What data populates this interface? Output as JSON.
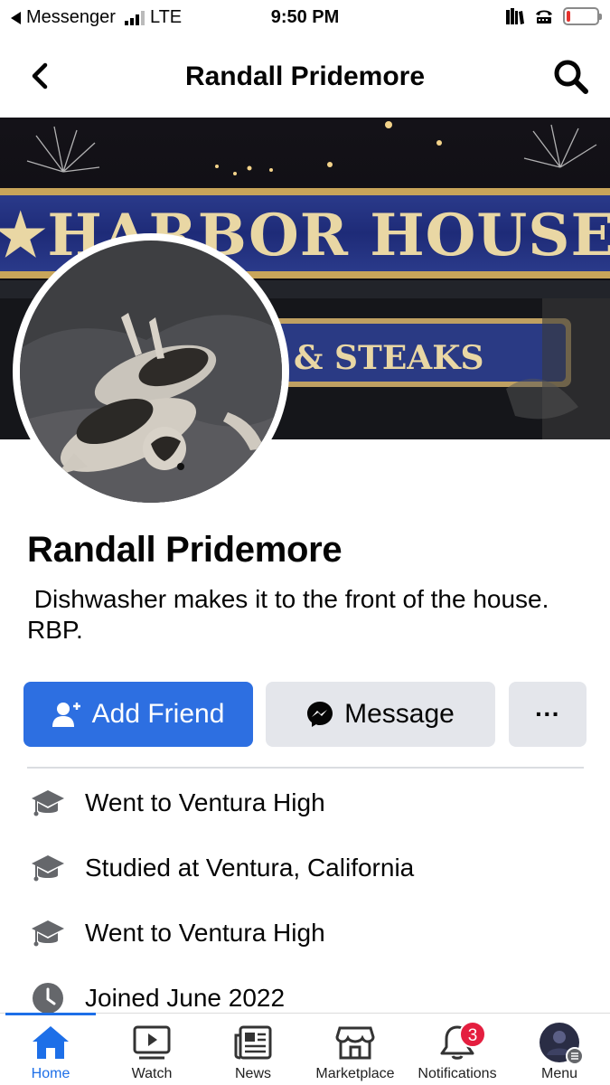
{
  "status_bar": {
    "back_app": "Messenger",
    "network": "LTE",
    "time": "9:50 PM",
    "battery_level": 0.12
  },
  "header": {
    "title": "Randall Pridemore"
  },
  "cover": {
    "sign_text_1": "★HARBOR HOUSE★",
    "sign_text_2": "& STEAKS"
  },
  "profile": {
    "name": "Randall Pridemore",
    "bio": " Dishwasher makes it to the front of the house. RBP."
  },
  "actions": {
    "add_friend_label": "Add Friend",
    "message_label": "Message",
    "more_label": "···"
  },
  "info": [
    {
      "icon": "education-icon",
      "text": "Went to Ventura High"
    },
    {
      "icon": "education-icon",
      "text": "Studied at Ventura, California"
    },
    {
      "icon": "education-icon",
      "text": "Went to Ventura High"
    },
    {
      "icon": "clock-icon",
      "text": "Joined June 2022"
    }
  ],
  "tabbar": {
    "tabs": [
      {
        "label": "Home",
        "icon": "home-icon",
        "active": true
      },
      {
        "label": "Watch",
        "icon": "watch-icon"
      },
      {
        "label": "News",
        "icon": "news-icon"
      },
      {
        "label": "Marketplace",
        "icon": "marketplace-icon"
      },
      {
        "label": "Notifications",
        "icon": "bell-icon",
        "badge": "3"
      },
      {
        "label": "Menu",
        "icon": "menu-avatar-icon"
      }
    ]
  },
  "colors": {
    "primary": "#2d6fe1",
    "secondary_button": "#e4e6eb",
    "badge": "#e41e3f"
  }
}
